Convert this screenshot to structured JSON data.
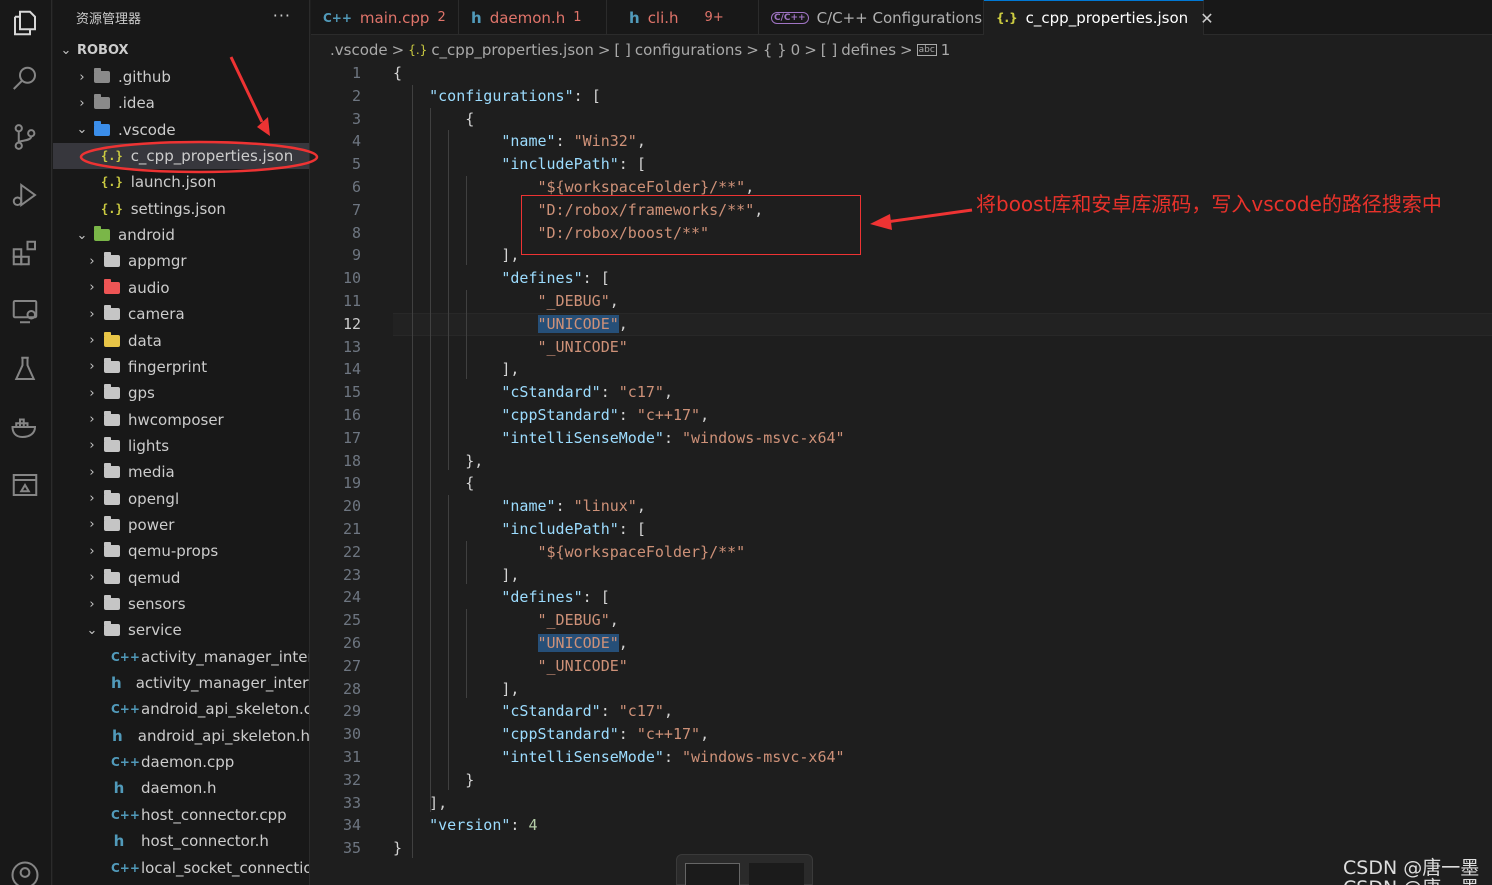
{
  "sidebar": {
    "title": "资源管理器",
    "more": "···",
    "root": "ROBOX",
    "rows": [
      {
        "label": ".github",
        "kind": "folder",
        "chev": "›",
        "indent": 1
      },
      {
        "label": ".idea",
        "kind": "folder",
        "chev": "›",
        "indent": 1
      },
      {
        "label": ".vscode",
        "kind": "folder-open",
        "chev": "⌄",
        "indent": 1
      },
      {
        "label": "c_cpp_properties.json",
        "kind": "json",
        "chev": "",
        "indent": 2
      },
      {
        "label": "launch.json",
        "kind": "json",
        "chev": "",
        "indent": 2
      },
      {
        "label": "settings.json",
        "kind": "json",
        "chev": "",
        "indent": 2
      },
      {
        "label": "android",
        "kind": "folder-open",
        "chev": "⌄",
        "indent": 1
      },
      {
        "label": "appmgr",
        "kind": "folder",
        "chev": "›",
        "indent": 2
      },
      {
        "label": "audio",
        "kind": "folder",
        "chev": "›",
        "indent": 2
      },
      {
        "label": "camera",
        "kind": "folder",
        "chev": "›",
        "indent": 2
      },
      {
        "label": "data",
        "kind": "folder",
        "chev": "›",
        "indent": 2
      },
      {
        "label": "fingerprint",
        "kind": "folder",
        "chev": "›",
        "indent": 2
      },
      {
        "label": "gps",
        "kind": "folder",
        "chev": "›",
        "indent": 2
      },
      {
        "label": "hwcomposer",
        "kind": "folder",
        "chev": "›",
        "indent": 2
      },
      {
        "label": "lights",
        "kind": "folder",
        "chev": "›",
        "indent": 2
      },
      {
        "label": "media",
        "kind": "folder",
        "chev": "›",
        "indent": 2
      },
      {
        "label": "opengl",
        "kind": "folder",
        "chev": "›",
        "indent": 2
      },
      {
        "label": "power",
        "kind": "folder",
        "chev": "›",
        "indent": 2
      },
      {
        "label": "qemu-props",
        "kind": "folder",
        "chev": "›",
        "indent": 2
      },
      {
        "label": "qemud",
        "kind": "folder",
        "chev": "›",
        "indent": 2
      },
      {
        "label": "sensors",
        "kind": "folder",
        "chev": "›",
        "indent": 2
      },
      {
        "label": "service",
        "kind": "folder-open",
        "chev": "⌄",
        "indent": 2
      },
      {
        "label": "activity_manager_interf...",
        "kind": "cpp",
        "chev": "",
        "indent": 3
      },
      {
        "label": "activity_manager_interf...",
        "kind": "h",
        "chev": "",
        "indent": 3
      },
      {
        "label": "android_api_skeleton.c...",
        "kind": "cpp",
        "chev": "",
        "indent": 3
      },
      {
        "label": "android_api_skeleton.h",
        "kind": "h",
        "chev": "",
        "indent": 3
      },
      {
        "label": "daemon.cpp",
        "kind": "cpp",
        "chev": "",
        "indent": 3
      },
      {
        "label": "daemon.h",
        "kind": "h",
        "chev": "",
        "indent": 3
      },
      {
        "label": "host_connector.cpp",
        "kind": "cpp",
        "chev": "",
        "indent": 3
      },
      {
        "label": "host_connector.h",
        "kind": "h",
        "chev": "",
        "indent": 3
      },
      {
        "label": "local_socket_connectio...",
        "kind": "cpp",
        "chev": "",
        "indent": 3
      }
    ]
  },
  "tabs": [
    {
      "icon": "C++",
      "label": "main.cpp",
      "badge": "2",
      "color": "#e0746a",
      "icon_color": "#519aba"
    },
    {
      "icon": "h",
      "label": "daemon.h",
      "badge": "1",
      "color": "#e0746a",
      "icon_color": "#519aba"
    },
    {
      "icon": "h",
      "label": "cli.h",
      "badge": "9+",
      "color": "#e0746a",
      "icon_color": "#519aba"
    },
    {
      "icon": "C/C++",
      "label": "C/C++ Configurations",
      "badge": "",
      "color": "#cccccc",
      "icon_color": "#a074c4"
    },
    {
      "icon": "{.}",
      "label": "c_cpp_properties.json",
      "badge": "",
      "color": "#ffffff",
      "icon_color": "#cbcb41",
      "close": "✕"
    }
  ],
  "breadcrumb": [
    ".vscode",
    ">",
    "{.}",
    "c_cpp_properties.json",
    ">",
    "[ ]",
    "configurations",
    ">",
    "{ }",
    "0",
    ">",
    "[ ]",
    "defines",
    ">",
    "abc",
    "1"
  ],
  "editor": {
    "current_line": 12,
    "lines": [
      "1",
      "2",
      "3",
      "4",
      "5",
      "6",
      "7",
      "8",
      "9",
      "10",
      "11",
      "12",
      "13",
      "14",
      "15",
      "16",
      "17",
      "18",
      "19",
      "20",
      "21",
      "22",
      "23",
      "24",
      "25",
      "26",
      "27",
      "28",
      "29",
      "30",
      "31",
      "32",
      "33",
      "34",
      "35"
    ]
  },
  "annotation": {
    "text": "将boost库和安卓库源码，写入vscode的路径搜索中",
    "color": "#e8322b"
  },
  "watermark": "CSDN @唐一墨",
  "colors": {
    "key": "#9cdcfe",
    "string": "#ce9178",
    "number": "#b5cea8",
    "accent": "#0078d4"
  }
}
